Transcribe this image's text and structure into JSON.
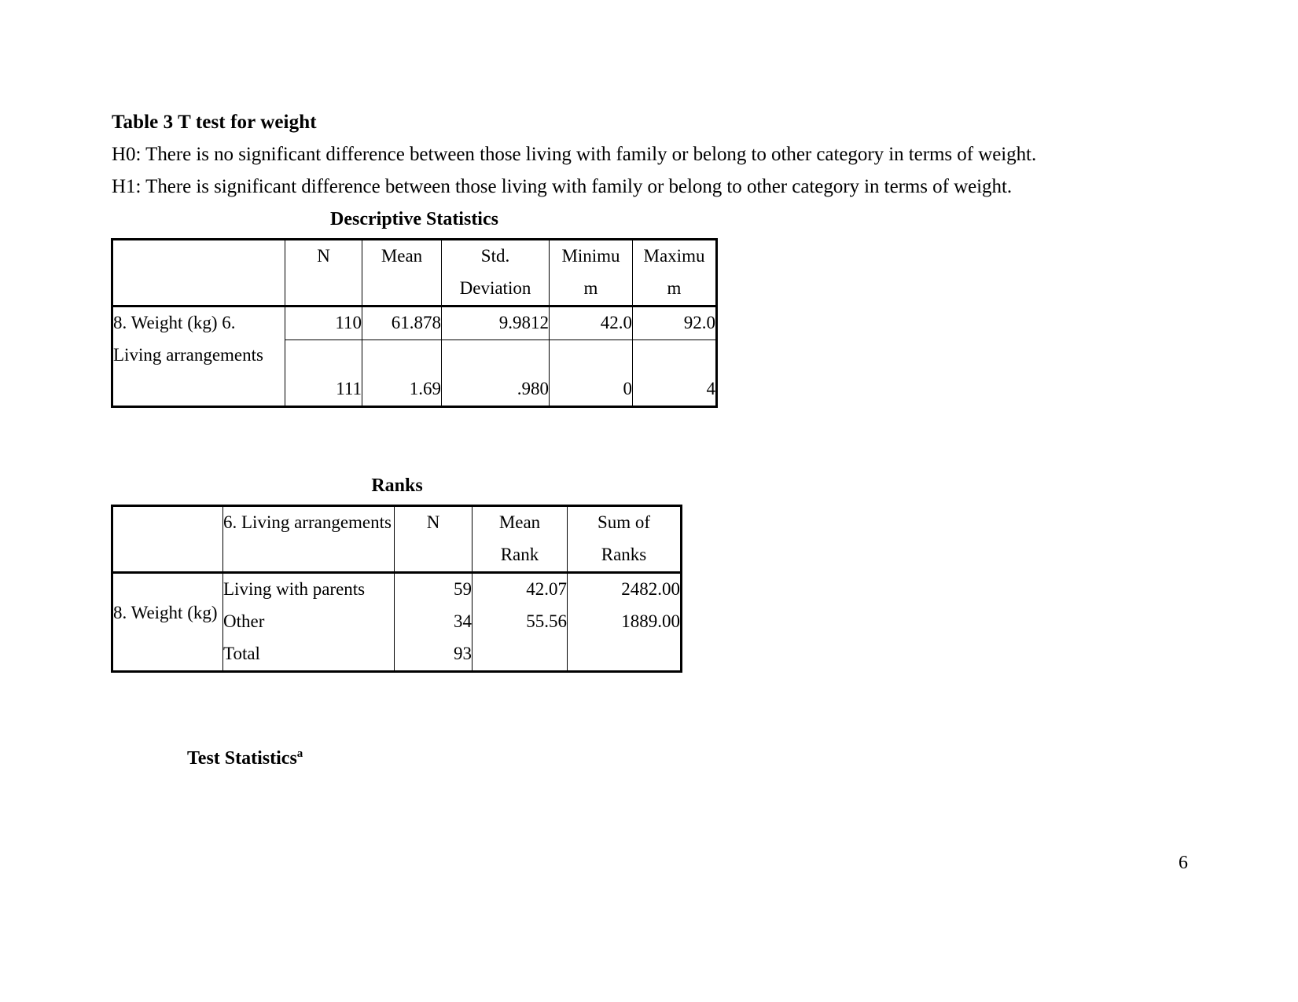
{
  "document": {
    "title": "Table 3 T test for weight",
    "hypotheses": [
      "H0: There is no significant difference between those living with family or belong to other category in terms of weight.",
      "H1: There is significant difference between those living with family or belong to other category in terms of weight."
    ],
    "page_number": "6"
  },
  "descriptive_statistics": {
    "caption": "Descriptive Statistics",
    "headers": [
      {
        "line1": "",
        "line2": ""
      },
      {
        "line1": "N",
        "line2": ""
      },
      {
        "line1": "Mean",
        "line2": ""
      },
      {
        "line1": "Std.",
        "line2": "Deviation"
      },
      {
        "line1": "Minimu",
        "line2": "m"
      },
      {
        "line1": "Maximu",
        "line2": "m"
      }
    ],
    "rows": [
      {
        "label_line1": "8. Weight (kg)",
        "label_line2": "",
        "label_line3": "",
        "n": "110",
        "mean": "61.878",
        "std_deviation": "9.9812",
        "minimum": "42.0",
        "maximum": "92.0"
      },
      {
        "label_line1": "6. Living",
        "label_line2": "arrangements",
        "label_line3": "",
        "n": "111",
        "mean": "1.69",
        "std_deviation": ".980",
        "minimum": "0",
        "maximum": "4"
      }
    ]
  },
  "ranks": {
    "caption": "Ranks",
    "headers": [
      {
        "line1": "",
        "line2": ""
      },
      {
        "line1": "6. Living",
        "line2": "arrangements"
      },
      {
        "line1": "N",
        "line2": ""
      },
      {
        "line1": "Mean",
        "line2": "Rank"
      },
      {
        "line1": "Sum of",
        "line2": "Ranks"
      }
    ],
    "row_group_label_line1": "8. Weight",
    "row_group_label_line2": "(kg)",
    "rows": [
      {
        "group": "Living with parents",
        "n": "59",
        "mean_rank": "42.07",
        "sum_of_ranks": "2482.00"
      },
      {
        "group": "Other",
        "n": "34",
        "mean_rank": "55.56",
        "sum_of_ranks": "1889.00"
      },
      {
        "group": "Total",
        "n": "93",
        "mean_rank": "",
        "sum_of_ranks": ""
      }
    ]
  },
  "test_statistics": {
    "caption": "Test Statistics",
    "footnote_marker": "a"
  }
}
